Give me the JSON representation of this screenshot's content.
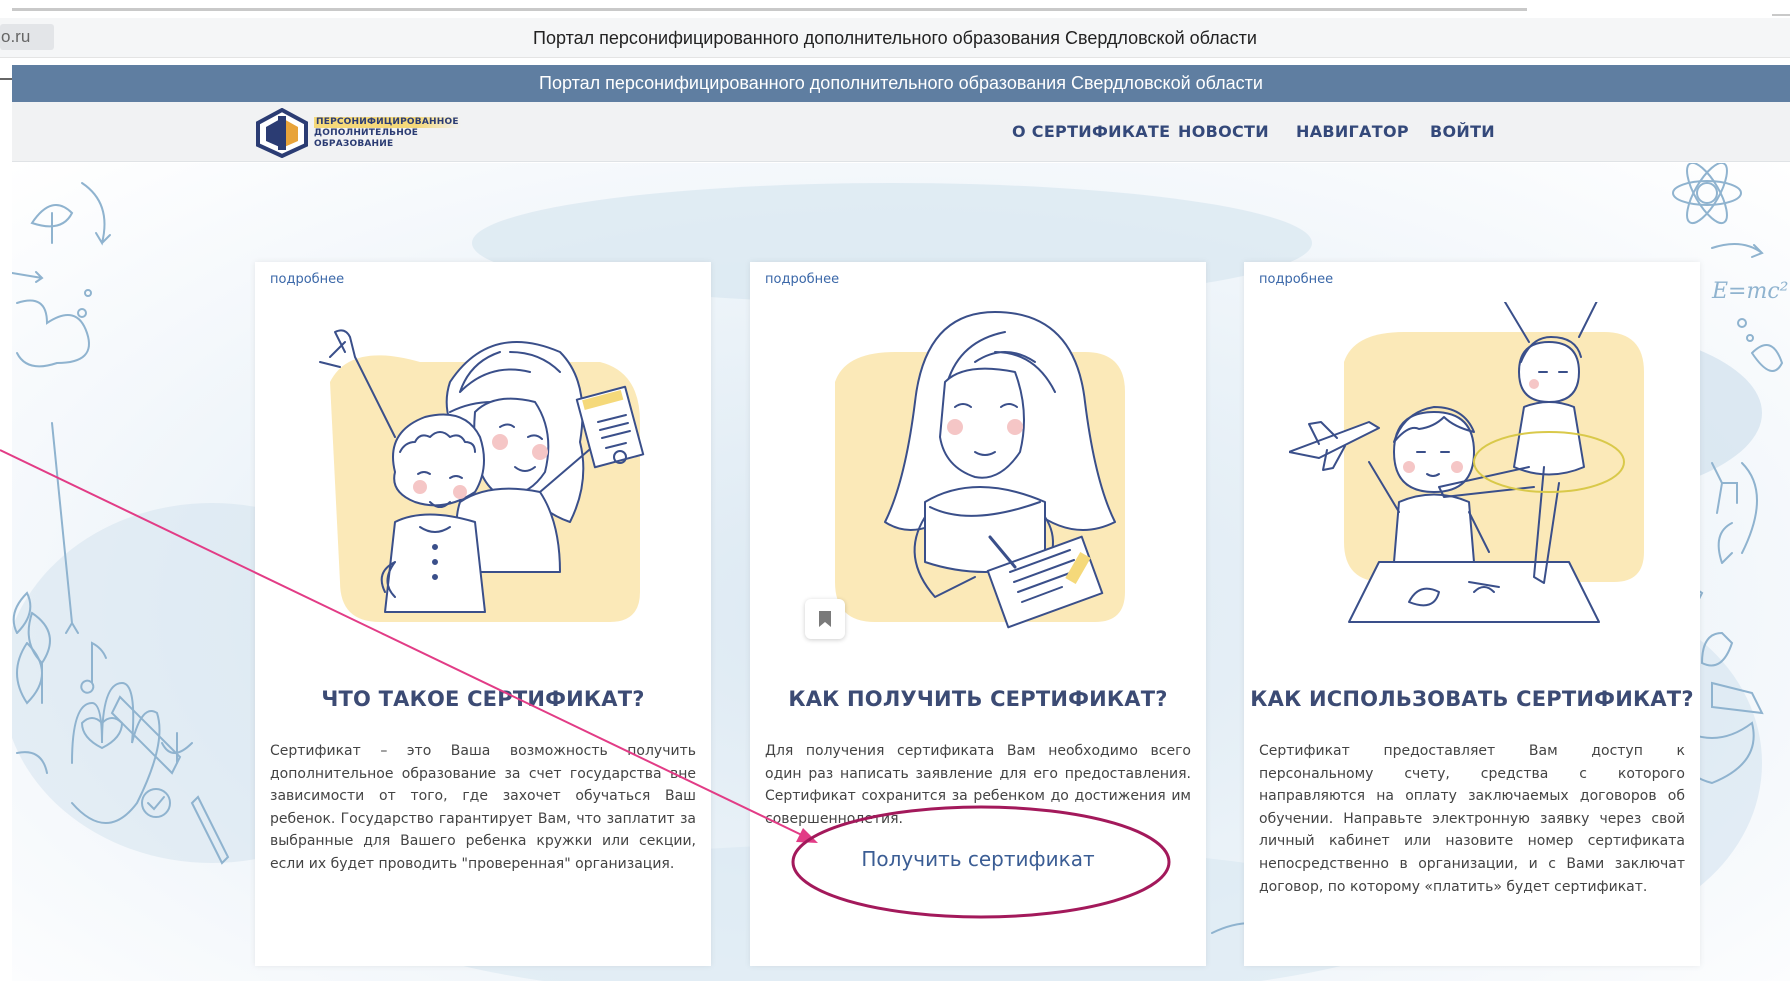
{
  "browser": {
    "url_fragment": "o.ru",
    "window_title": "Портал персонифицированного дополнительного образования Свердловской области"
  },
  "banner": {
    "text": "Портал персонифицированного дополнительного образования Свердловской области"
  },
  "logo": {
    "lines": [
      "ПЕРСОНИФИЦИРОВАННОЕ",
      "ДОПОЛНИТЕЛЬНОЕ",
      "ОБРАЗОВАНИЕ"
    ],
    "colors": {
      "navy": "#2b3c73",
      "yellow": "#f5d97a",
      "orange": "#e8a33a"
    }
  },
  "nav": {
    "items": [
      {
        "label": "О СЕРТИФИКАТЕ"
      },
      {
        "label": "НОВОСТИ"
      },
      {
        "label": "НАВИГАТОР"
      },
      {
        "label": "ВОЙТИ"
      }
    ]
  },
  "cards": [
    {
      "more": "подробнее",
      "title": "ЧТО ТАКОЕ СЕРТИФИКАТ?",
      "text": "Сертификат – это Ваша возможность получить дополнительное образование за счет государства вне зависимости от того, где захочет обучаться Ваш ребенок. Государство гарантирует Вам, что заплатит за выбранные для Вашего ребенка кружки или секции, если их будет проводить \"проверенная\" организация.",
      "illustration": "mother-daughter-certificate"
    },
    {
      "more": "подробнее",
      "title": "КАК ПОЛУЧИТЬ СЕРТИФИКАТ?",
      "text": "Для получения сертификата Вам необходимо всего один раз написать заявление для его предоставления. Сертификат сохранится за ребенком до достижения им совершеннолетия.",
      "link": "Получить сертификат",
      "illustration": "woman-writing-application"
    },
    {
      "more": "подробнее",
      "title": "КАК ИСПОЛЬЗОВАТЬ СЕРТИФИКАТ?",
      "text": "Сертификат предоставляет Вам доступ к персональному счету, средства с которого направляются на оплату заключаемых договоров об обучении. Направьте электронную заявку через свой личный кабинет или назовите номер сертификата непосредственно в организации, и с Вами заключат договор, по которому «платить» будет сертификат.",
      "illustration": "boy-plane-ballerina"
    }
  ],
  "colors": {
    "banner": "#5f7ea1",
    "nav_text": "#34497a",
    "title_text": "#3c4b74",
    "link": "#3b5d94",
    "illustration_yellow": "#fbe9b8",
    "annotation_arrow": "#e23c86",
    "annotation_ellipse": "#a3195b"
  }
}
